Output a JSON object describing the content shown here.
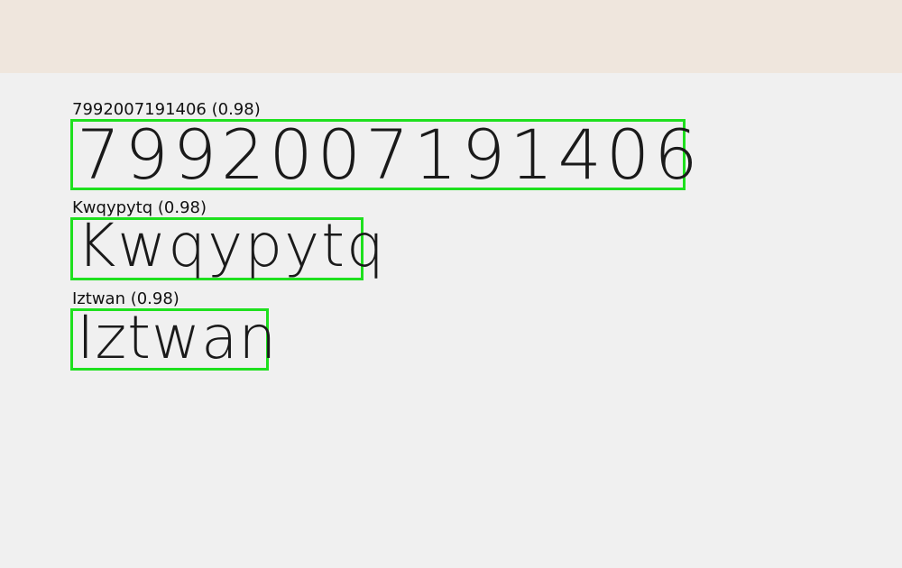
{
  "colors": {
    "background": "#f0f0f0",
    "header_band": "#efe6dd",
    "box_border": "#1ee01e",
    "text": "#111111"
  },
  "detections": [
    {
      "text": "7992007191406",
      "label": "7992007191406 (0.98)",
      "confidence": 0.98
    },
    {
      "text": "Kwqypytq",
      "label": "Kwqypytq (0.98)",
      "confidence": 0.98
    },
    {
      "text": "Iztwan",
      "label": "Iztwan (0.98)",
      "confidence": 0.98
    }
  ]
}
